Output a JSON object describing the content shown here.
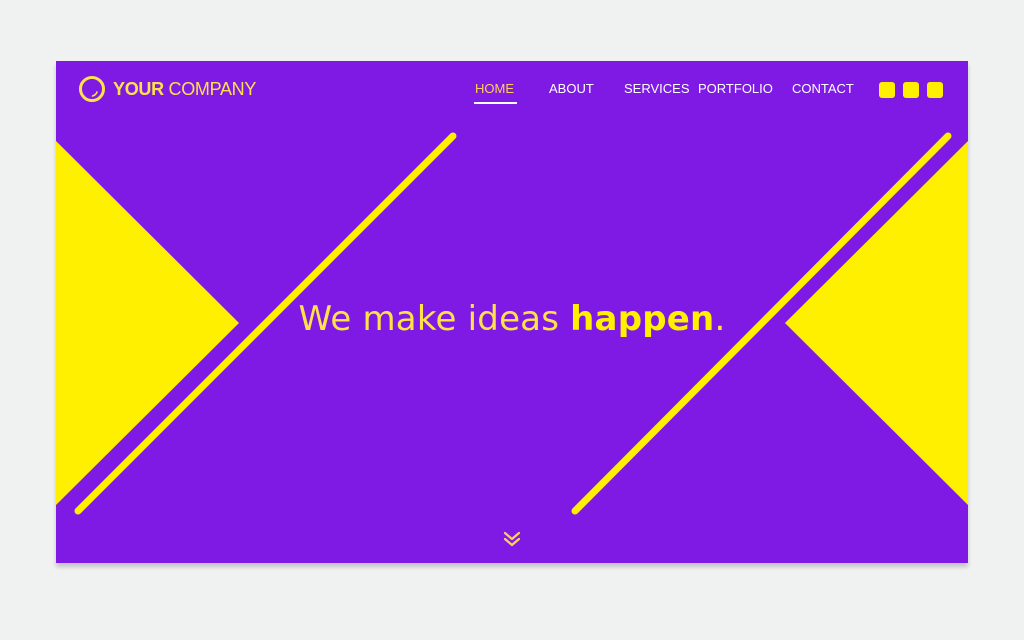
{
  "brand": {
    "bold": "YOUR",
    "light": "COMPANY",
    "logo_icon": "ring-icon"
  },
  "nav": {
    "items": [
      {
        "label": "HOME",
        "active": true
      },
      {
        "label": "ABOUT",
        "active": false
      },
      {
        "label": "SERVICES",
        "active": false
      },
      {
        "label": "PORTFOLIO",
        "active": false
      },
      {
        "label": "CONTACT",
        "active": false
      }
    ],
    "square_buttons": 3
  },
  "hero": {
    "headline_regular": "We make ideas ",
    "headline_bold": "happen",
    "headline_end": "."
  },
  "scroll_icon": "double-chevron-down-icon",
  "colors": {
    "background": "#f0f1f1",
    "panel": "#7f1ae5",
    "accent": "#fff000",
    "text_accent": "#ffe14a",
    "nav_text": "#ffffff",
    "nav_active": "#ffcf5a"
  }
}
